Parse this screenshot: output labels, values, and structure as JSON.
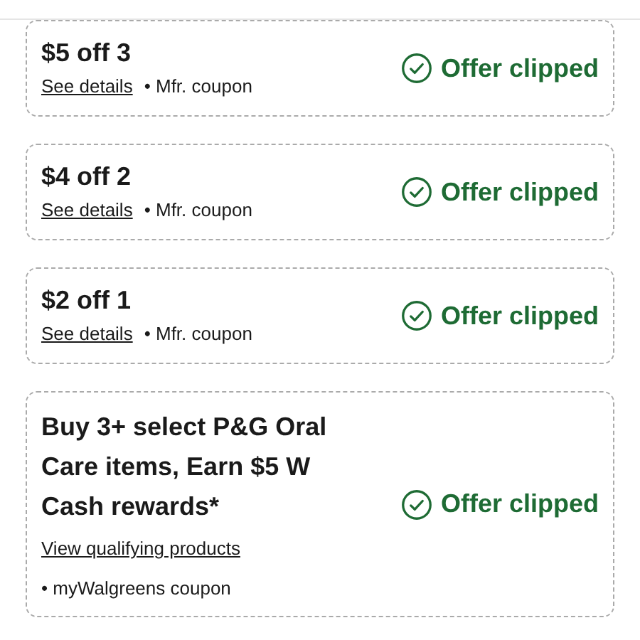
{
  "coupons": [
    {
      "title": "$5 off 3",
      "link": "See details",
      "source": "• Mfr. coupon",
      "kind": "inline",
      "clipped": true,
      "status": "Offer clipped"
    },
    {
      "title": "$4 off 2",
      "link": "See details",
      "source": "• Mfr. coupon",
      "kind": "inline",
      "clipped": true,
      "status": "Offer clipped"
    },
    {
      "title": "$2 off 1",
      "link": "See details",
      "source": "• Mfr. coupon",
      "kind": "inline",
      "clipped": true,
      "status": "Offer clipped"
    },
    {
      "title": "Buy 3+ select P&G Oral Care items, Earn $5 W Cash rewards*",
      "link": "View qualifying products",
      "source": "• myWalgreens coupon",
      "kind": "stacked",
      "clipped": true,
      "status": "Offer clipped"
    }
  ]
}
